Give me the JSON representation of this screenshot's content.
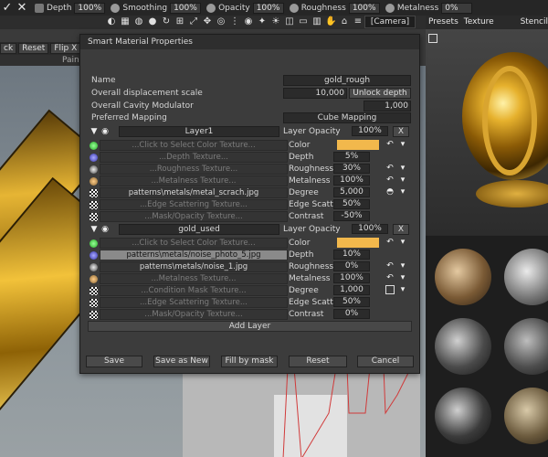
{
  "toolbar": {
    "depth_label": "Depth",
    "depth_value": "100%",
    "smoothing_label": "Smoothing",
    "smoothing_value": "100%",
    "opacity_label": "Opacity",
    "opacity_value": "100%",
    "roughness_label": "Roughness",
    "roughness_value": "100%",
    "metalness_label": "Metalness",
    "metalness_value": "0%"
  },
  "view": {
    "camera_label": "[Camera]"
  },
  "right_tabs": [
    "Presets",
    "Texture Editor",
    "Stencil"
  ],
  "left_toolbar": {
    "buttons": [
      "ck",
      "Reset",
      "Flip X"
    ],
    "paint_label": "Paint"
  },
  "dialog": {
    "title": "Smart Material Properties",
    "name_label": "Name",
    "name_value": "gold_rough",
    "disp_label": "Overall displacement scale",
    "disp_value": "10,000",
    "unlock_label": "Unlock depth",
    "cavity_label": "Overall Cavity Modulator",
    "cavity_value": "1,000",
    "mapping_label": "Preferred Mapping",
    "mapping_value": "Cube Mapping",
    "layer1": {
      "name": "Layer1",
      "opacity_label": "Layer Opacity",
      "opacity_value": "100%",
      "close": "X",
      "rows": [
        {
          "tex": "...Click to Select Color Texture...",
          "param": "Color",
          "value": "",
          "icon": "green-ball"
        },
        {
          "tex": "...Depth Texture...",
          "param": "Depth",
          "value": "5%",
          "icon": "blue-ball"
        },
        {
          "tex": "...Roughness Texture...",
          "param": "Roughness",
          "value": "30%",
          "icon": "dark-ball"
        },
        {
          "tex": "...Metalness Texture...",
          "param": "Metalness",
          "value": "100%",
          "icon": "orange-ball"
        },
        {
          "tex": "patterns\\metals/metal_scrach.jpg",
          "param": "Degree",
          "value": "5,000",
          "icon": "checker"
        },
        {
          "tex": "...Edge Scattering Texture...",
          "param": "Edge Scattering",
          "value": "50%",
          "icon": "checker"
        },
        {
          "tex": "...Mask/Opacity Texture...",
          "param": "Contrast",
          "value": "-50%",
          "icon": "checker"
        }
      ]
    },
    "layer2": {
      "name": "gold_used",
      "opacity_label": "Layer Opacity",
      "opacity_value": "100%",
      "close": "X",
      "rows": [
        {
          "tex": "...Click to Select Color Texture...",
          "param": "Color",
          "value": "",
          "icon": "green-ball"
        },
        {
          "tex": "patterns\\metals/noise_photo_5.jpg",
          "param": "Depth",
          "value": "10%",
          "icon": "blue-ball"
        },
        {
          "tex": "patterns\\metals/noise_1.jpg",
          "param": "Roughness",
          "value": "0%",
          "icon": "dark-ball"
        },
        {
          "tex": "...Metalness Texture...",
          "param": "Metalness",
          "value": "100%",
          "icon": "orange-ball"
        },
        {
          "tex": "...Condition Mask Texture...",
          "param": "Degree",
          "value": "1,000",
          "icon": "checker"
        },
        {
          "tex": "...Edge Scattering Texture...",
          "param": "Edge Scattering",
          "value": "50%",
          "icon": "checker"
        },
        {
          "tex": "...Mask/Opacity Texture...",
          "param": "Contrast",
          "value": "0%",
          "icon": "checker"
        }
      ]
    },
    "add_layer": "Add Layer",
    "buttons": {
      "save": "Save",
      "save_as_new": "Save as New",
      "fill_by_mask": "Fill by mask",
      "reset": "Reset",
      "cancel": "Cancel"
    }
  },
  "colors": {
    "gold": "#f2b84c",
    "accent": "#e0a526"
  }
}
